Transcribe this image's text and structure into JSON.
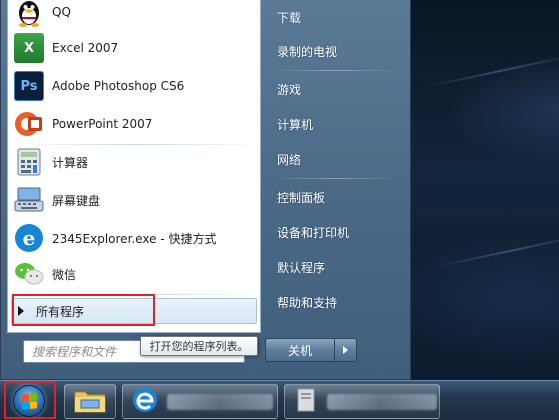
{
  "programs": [
    {
      "label": "QQ",
      "icon": "qq-penguin-icon"
    },
    {
      "label": "Excel 2007",
      "icon": "excel-icon"
    },
    {
      "label": "Adobe Photoshop CS6",
      "icon": "photoshop-icon"
    },
    {
      "label": "PowerPoint 2007",
      "icon": "powerpoint-icon"
    },
    {
      "label": "计算器",
      "icon": "calculator-icon"
    },
    {
      "label": "屏幕键盘",
      "icon": "on-screen-keyboard-icon"
    },
    {
      "label": "2345Explorer.exe - 快捷方式",
      "icon": "browser-e-icon"
    },
    {
      "label": "微信",
      "icon": "wechat-icon"
    }
  ],
  "icons": {
    "excel_text": "X",
    "photoshop_text": "Ps",
    "browser_text": "e"
  },
  "all_programs": {
    "label": "所有程序"
  },
  "search": {
    "placeholder": "搜索程序和文件"
  },
  "tooltip": {
    "text": "打开您的程序列表。"
  },
  "right_items": [
    {
      "label": "下载"
    },
    {
      "label": "录制的电视"
    },
    {
      "label": "游戏"
    },
    {
      "label": "计算机"
    },
    {
      "label": "网络"
    },
    {
      "label": "控制面板"
    },
    {
      "label": "设备和打印机"
    },
    {
      "label": "默认程序"
    },
    {
      "label": "帮助和支持"
    }
  ],
  "shutdown": {
    "label": "关机"
  },
  "colors": {
    "highlight_box": "#e02222",
    "menu_right_bg": "#4a6a87",
    "all_programs_bg": "#d6e6f6"
  }
}
